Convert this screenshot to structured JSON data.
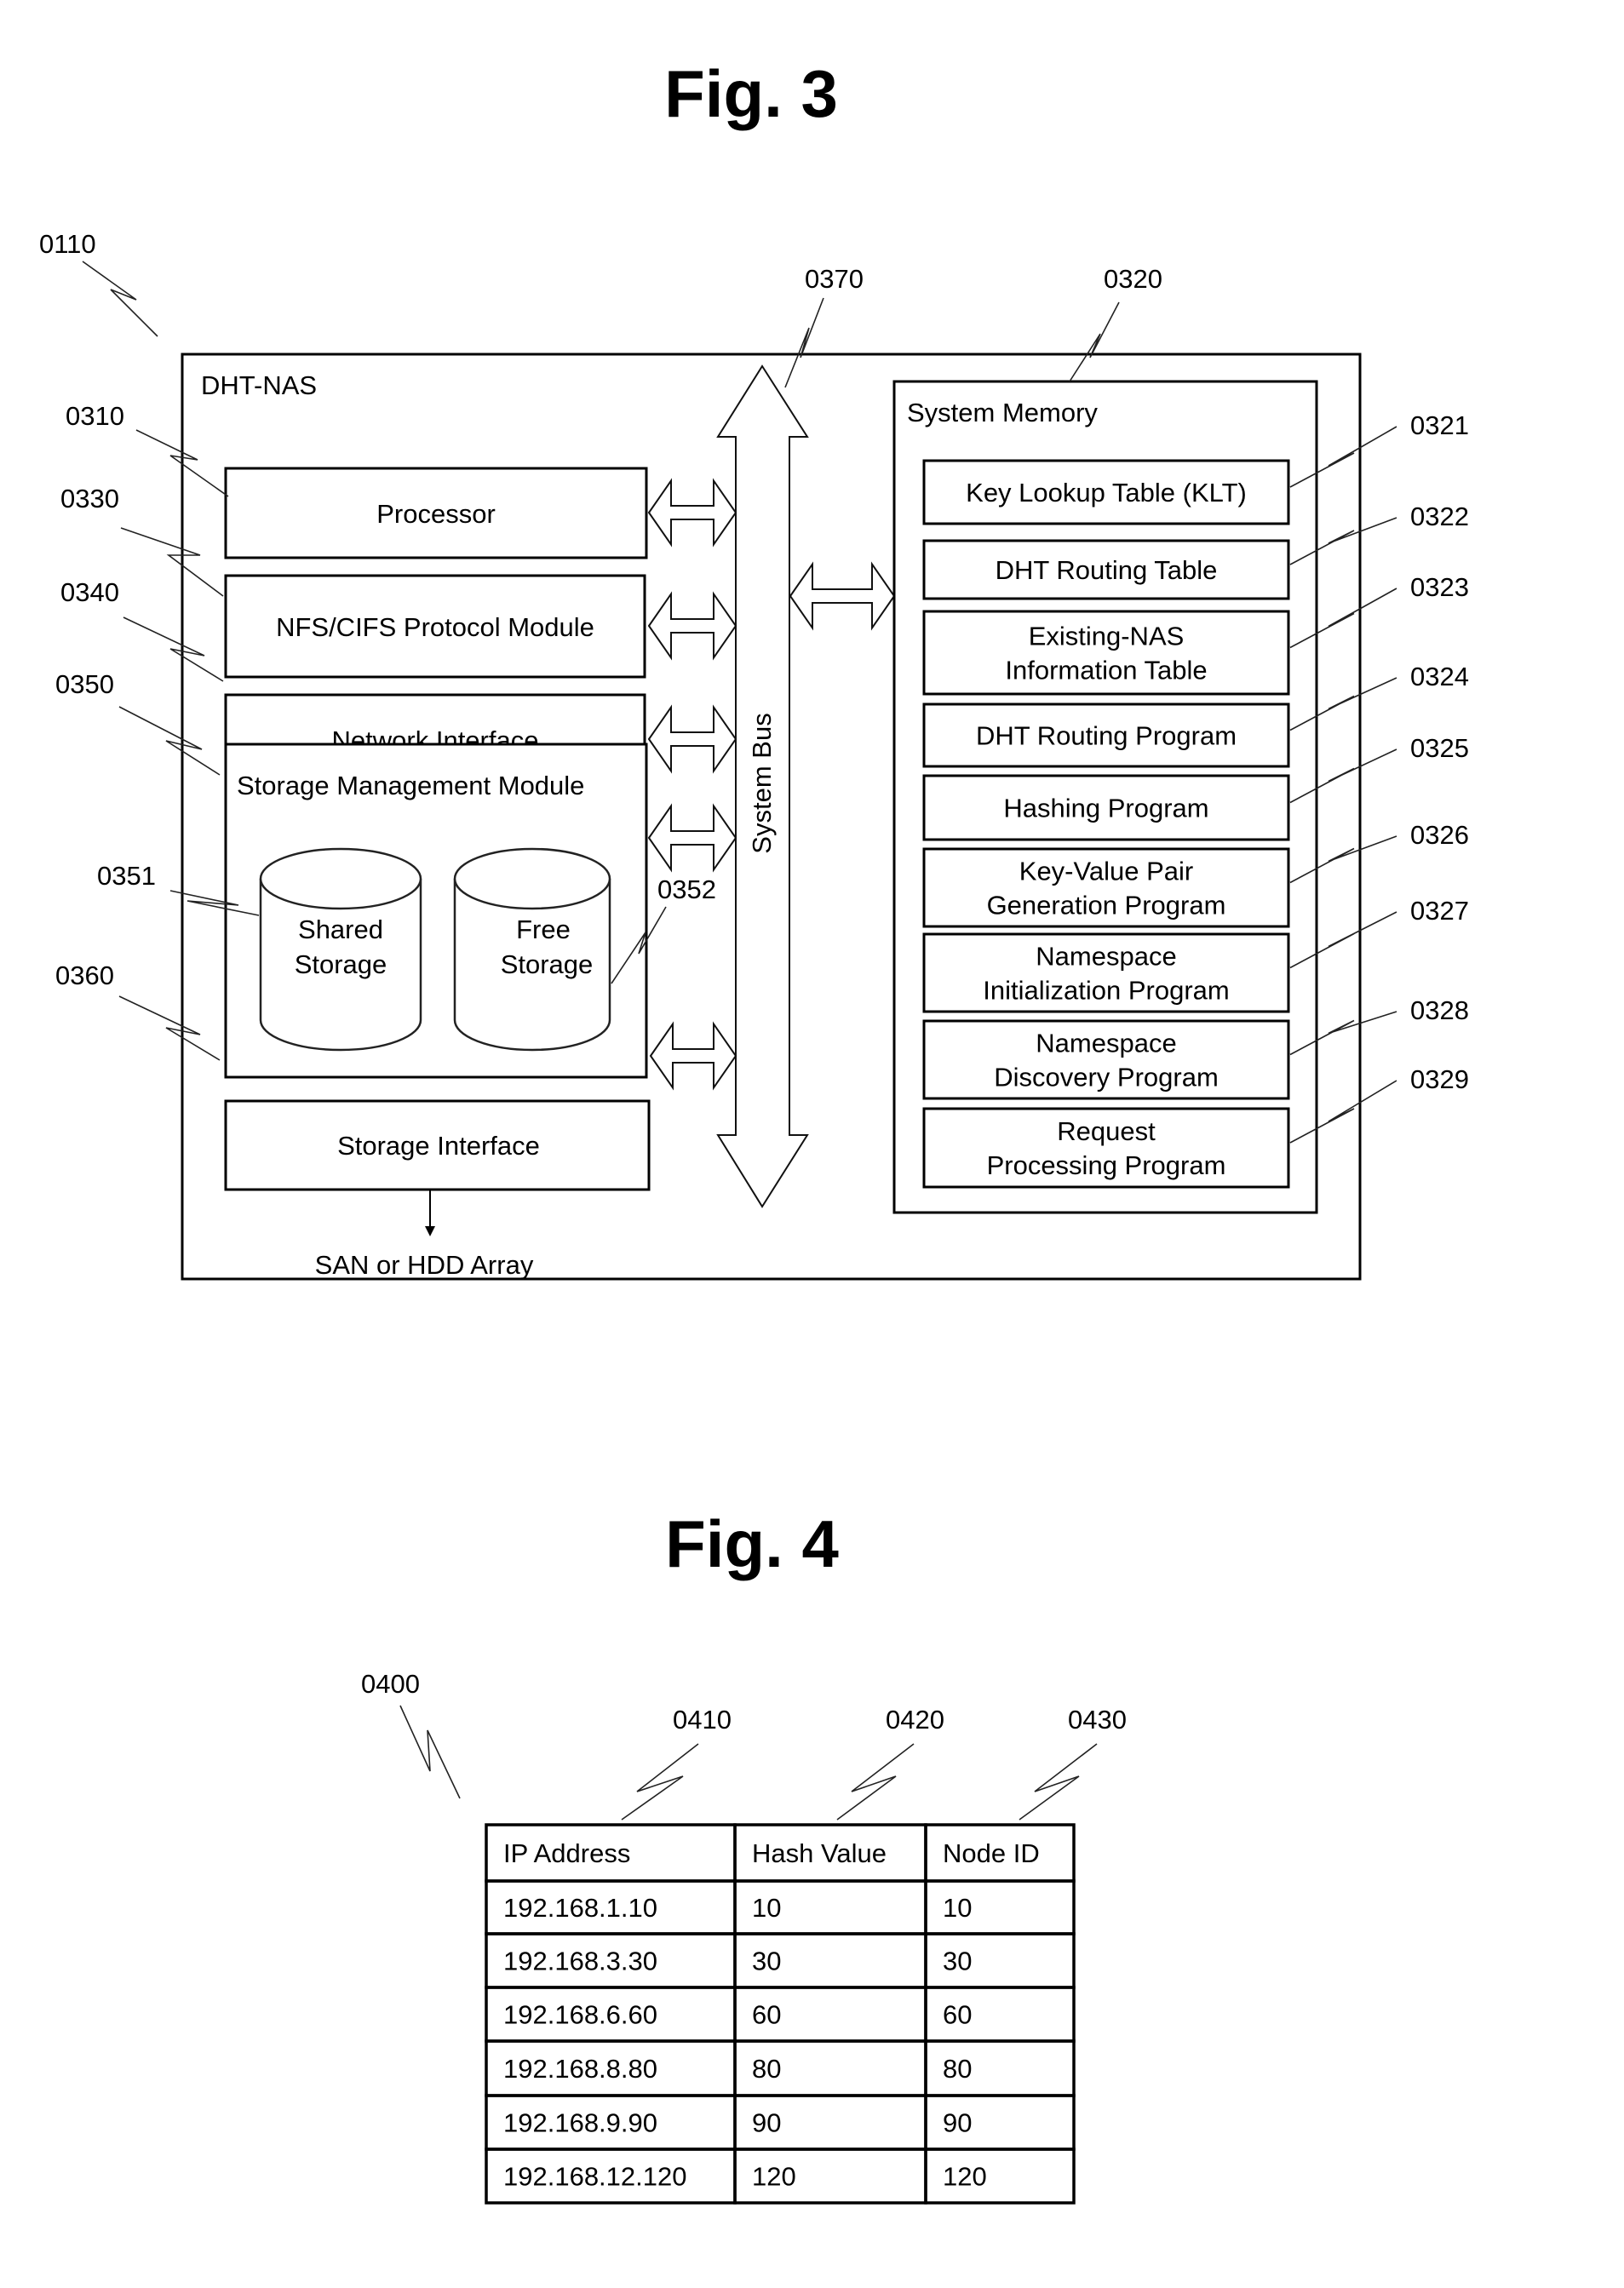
{
  "fig3": {
    "title": "Fig. 3",
    "device_label": "DHT-NAS",
    "refs": {
      "device": "0110",
      "processor": "0310",
      "system_memory": "0320",
      "protocol_module": "0330",
      "network_interface": "0340",
      "storage_mgmt": "0350",
      "shared_storage": "0351",
      "free_storage": "0352",
      "storage_interface": "0360",
      "system_bus": "0370"
    },
    "left_modules": {
      "processor": "Processor",
      "protocol_module": "NFS/CIFS Protocol Module",
      "network_interface": "Network Interface",
      "storage_mgmt": "Storage Management Module",
      "shared_storage": [
        "Shared",
        "Storage"
      ],
      "free_storage": [
        "Free",
        "Storage"
      ],
      "storage_interface": "Storage Interface",
      "external": "SAN or HDD Array"
    },
    "bus_label": "System Bus",
    "memory": {
      "title": "System Memory",
      "items": [
        {
          "ref": "0321",
          "lines": [
            "Key Lookup Table (KLT)"
          ]
        },
        {
          "ref": "0322",
          "lines": [
            "DHT Routing Table"
          ]
        },
        {
          "ref": "0323",
          "lines": [
            "Existing-NAS",
            "Information Table"
          ]
        },
        {
          "ref": "0324",
          "lines": [
            "DHT Routing Program"
          ]
        },
        {
          "ref": "0325",
          "lines": [
            "Hashing Program"
          ]
        },
        {
          "ref": "0326",
          "lines": [
            "Key-Value Pair",
            "Generation Program"
          ]
        },
        {
          "ref": "0327",
          "lines": [
            "Namespace",
            "Initialization Program"
          ]
        },
        {
          "ref": "0328",
          "lines": [
            "Namespace",
            "Discovery Program"
          ]
        },
        {
          "ref": "0329",
          "lines": [
            "Request",
            "Processing Program"
          ]
        }
      ]
    }
  },
  "fig4": {
    "title": "Fig. 4",
    "refs": {
      "table": "0400",
      "ip_column": "0410",
      "hash_column": "0420",
      "node_column": "0430"
    },
    "table": {
      "headers": [
        "IP Address",
        "Hash Value",
        "Node ID"
      ],
      "rows": [
        [
          "192.168.1.10",
          "10",
          "10"
        ],
        [
          "192.168.3.30",
          "30",
          "30"
        ],
        [
          "192.168.6.60",
          "60",
          "60"
        ],
        [
          "192.168.8.80",
          "80",
          "80"
        ],
        [
          "192.168.9.90",
          "90",
          "90"
        ],
        [
          "192.168.12.120",
          "120",
          "120"
        ]
      ]
    }
  }
}
